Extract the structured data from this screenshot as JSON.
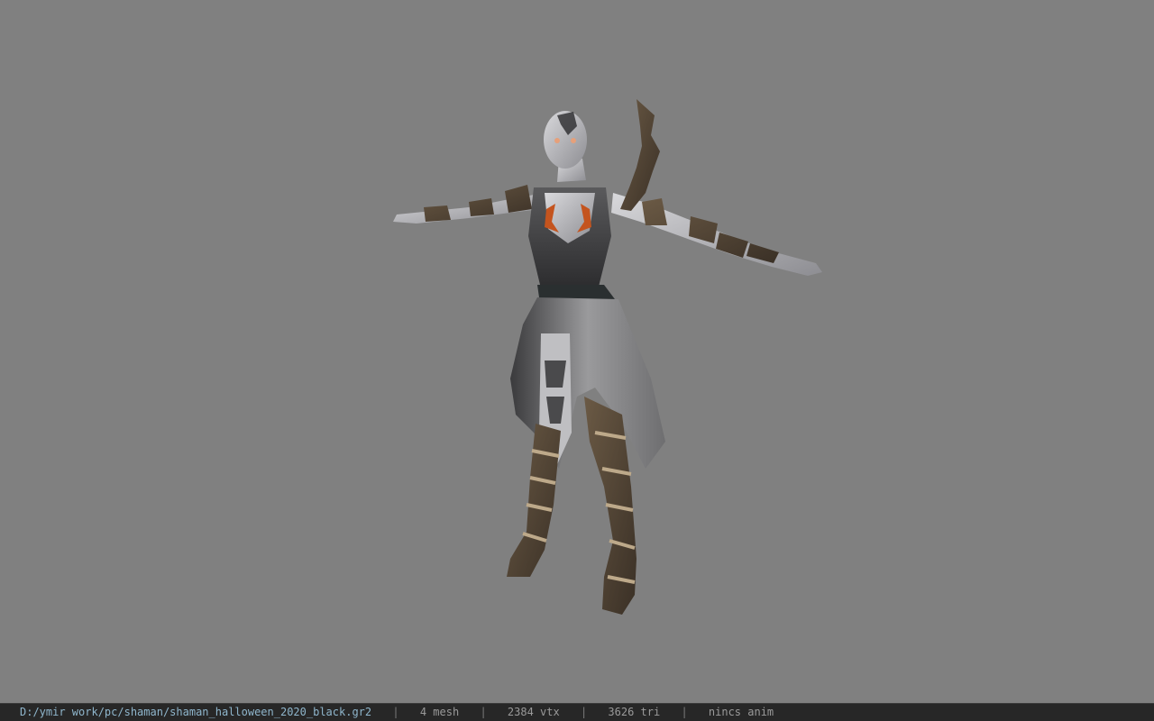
{
  "viewport": {
    "background": "#808080",
    "model_name": "shaman_halloween_2020_black"
  },
  "status_bar": {
    "file_path": "D:/ymir work/pc/shaman/shaman_halloween_2020_black.gr2",
    "separator": "|",
    "mesh_count": "4 mesh",
    "vertex_count": "2384 vtx",
    "triangle_count": "3626 tri",
    "anim_status": "nincs anim",
    "path_color": "#8fb6cc",
    "text_color": "#9a9a9a"
  }
}
